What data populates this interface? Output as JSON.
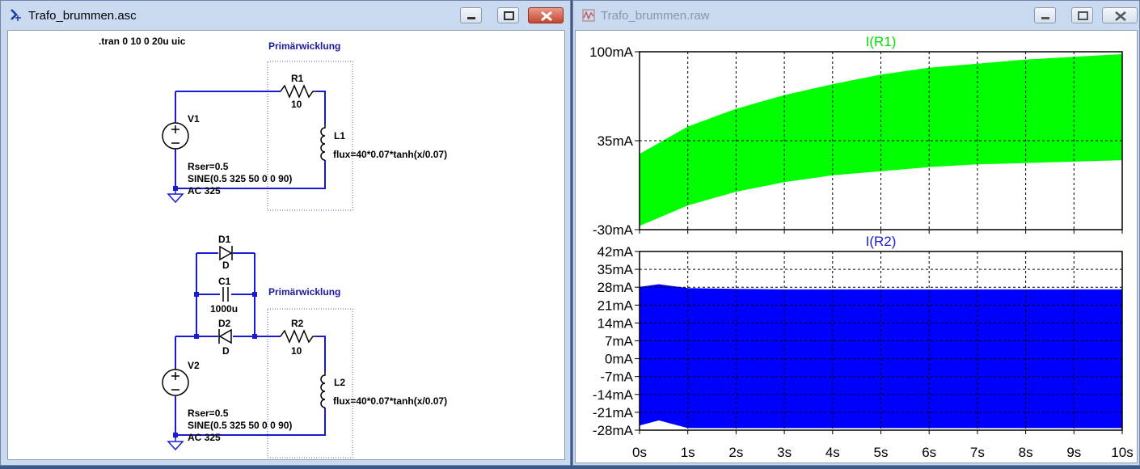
{
  "schematic_window": {
    "title": "Trafo_brummen.asc",
    "directive": ".tran 0 10 0 20u uic",
    "labels": {
      "prim1": "Primärwicklung",
      "prim2": "Primärwicklung",
      "r1_name": "R1",
      "r1_value": "10",
      "l1_name": "L1",
      "l1_value": "flux=40*0.07*tanh(x/0.07)",
      "v1_name": "V1",
      "v1_rser": "Rser=0.5",
      "v1_sine": "SINE(0.5 325 50 0 0 90)",
      "v1_ac": "AC 325",
      "d1_name": "D1",
      "d1_value": "D",
      "c1_name": "C1",
      "c1_value": "1000u",
      "d2_name": "D2",
      "d2_value": "D",
      "r2_name": "R2",
      "r2_value": "10",
      "l2_name": "L2",
      "l2_value": "flux=40*0.07*tanh(x/0.07)",
      "v2_name": "V2",
      "v2_rser": "Rser=0.5",
      "v2_sine": "SINE(0.5 325 50 0 0 90)",
      "v2_ac": "AC 325"
    }
  },
  "waveform_window": {
    "title": "Trafo_brummen.raw"
  },
  "colors": {
    "trace_r1": "#00ff00",
    "trace_r2": "#0000ff",
    "wire": "#1a1ad0",
    "title_r1": "#00e000",
    "title_r2": "#1a1ad0"
  },
  "chart_data": [
    {
      "type": "area",
      "title": "I(R1)",
      "x_ticks": [],
      "y_ticks": [
        "100mA",
        "35mA",
        "-30mA"
      ],
      "xlim": [
        0,
        10
      ],
      "ylim": [
        -30,
        100
      ],
      "grid": true,
      "series": [
        {
          "x": [
            0,
            1,
            2,
            3,
            4,
            5,
            6,
            7,
            8,
            9,
            10
          ],
          "upper": [
            25,
            45,
            58,
            68,
            76,
            83,
            88,
            91,
            94,
            96,
            98
          ],
          "lower": [
            -27,
            -12,
            -2,
            5,
            10,
            13,
            16,
            18,
            19,
            20,
            21
          ]
        }
      ]
    },
    {
      "type": "area",
      "title": "I(R2)",
      "x_ticks": [
        "0s",
        "1s",
        "2s",
        "3s",
        "4s",
        "5s",
        "6s",
        "7s",
        "8s",
        "9s",
        "10s"
      ],
      "y_ticks": [
        "42mA",
        "35mA",
        "28mA",
        "21mA",
        "14mA",
        "7mA",
        "0mA",
        "-7mA",
        "-14mA",
        "-21mA",
        "-28mA"
      ],
      "xlim": [
        0,
        10
      ],
      "ylim": [
        -28,
        42
      ],
      "grid": true,
      "series": [
        {
          "x": [
            0,
            0.4,
            1,
            2,
            3,
            4,
            5,
            6,
            7,
            8,
            9,
            10
          ],
          "upper": [
            28,
            29,
            27.5,
            27.2,
            27,
            27,
            27,
            27,
            27,
            27,
            27,
            27
          ],
          "lower": [
            -26,
            -24,
            -27,
            -27,
            -27,
            -27,
            -27,
            -27,
            -27,
            -27,
            -27,
            -27
          ]
        }
      ]
    }
  ]
}
